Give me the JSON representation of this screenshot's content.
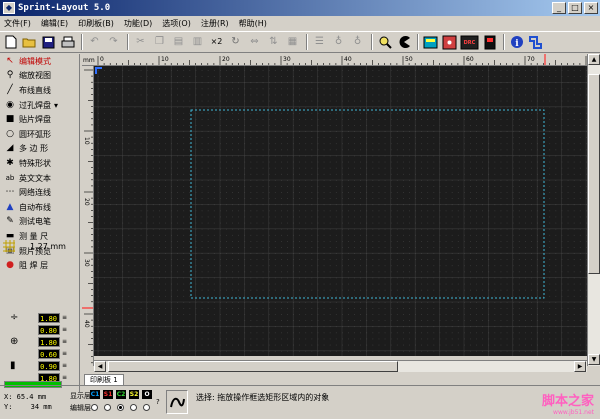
{
  "window": {
    "title": "Sprint-Layout 5.0",
    "minimize": "_",
    "maximize": "□",
    "close": "×"
  },
  "menu": [
    "文件(F)",
    "编辑(E)",
    "印刷板(B)",
    "功能(D)",
    "选项(O)",
    "注册(R)",
    "帮助(H)"
  ],
  "toolbar": {
    "new_icon": "file-new-icon",
    "open_icon": "folder-open-icon",
    "save_icon": "save-icon",
    "print_icon": "print-icon",
    "zoom_badge": "×2",
    "drc_label": "DRC"
  },
  "tools": [
    {
      "label": "编辑模式",
      "icon": "cursor-arrow-icon",
      "selected": true
    },
    {
      "label": "缩放视图",
      "icon": "zoom-icon"
    },
    {
      "label": "布线直线",
      "icon": "track-icon"
    },
    {
      "label": "过孔焊盘",
      "icon": "via-pad-icon",
      "has_arrow": true
    },
    {
      "label": "贴片焊盘",
      "icon": "smd-pad-icon"
    },
    {
      "label": "圆环弧形",
      "icon": "circle-arc-icon"
    },
    {
      "label": "多 边 形",
      "icon": "polygon-icon"
    },
    {
      "label": "特殊形状",
      "icon": "special-shape-icon"
    },
    {
      "label": "英文文本",
      "icon": "text-icon"
    },
    {
      "label": "网络连线",
      "icon": "net-connect-icon"
    },
    {
      "label": "自动布线",
      "icon": "autoroute-icon"
    },
    {
      "label": "测试电笔",
      "icon": "test-probe-icon"
    },
    {
      "label": "测 量 尺",
      "icon": "ruler-icon"
    },
    {
      "label": "照片预览",
      "icon": "photo-preview-icon"
    },
    {
      "label": "阻 焊 层",
      "icon": "solder-mask-icon"
    }
  ],
  "grid": {
    "value": "1.27 mm"
  },
  "params": [
    {
      "value": "1.80",
      "unit": "≡"
    },
    {
      "value": "0.80",
      "unit": "≡"
    },
    {
      "value": "1.80",
      "unit": "≡"
    },
    {
      "value": "0.60",
      "unit": "≡"
    },
    {
      "value": "0.90",
      "unit": "≡"
    },
    {
      "value": "1.80",
      "unit": "≡"
    }
  ],
  "ruler": {
    "unit": "mm",
    "top_marks": [
      "0",
      "10",
      "20",
      "30",
      "40",
      "50",
      "60",
      "70"
    ],
    "left_marks": [
      "10",
      "20",
      "30",
      "40"
    ]
  },
  "tab": {
    "label": "印刷板 1"
  },
  "status": {
    "x_label": "X:",
    "x_value": "65.4 mm",
    "y_label": "Y:",
    "y_value": "34 mm",
    "display_layer_label": "显示层",
    "edit_layer_label": "编辑层",
    "layers": [
      {
        "name": "C1",
        "color": "#00a0ff"
      },
      {
        "name": "S1",
        "color": "#ff3030"
      },
      {
        "name": "C2",
        "color": "#30d030"
      },
      {
        "name": "S2",
        "color": "#ffff30"
      },
      {
        "name": "O",
        "color": "#ffffff"
      }
    ],
    "help_mark": "?",
    "message": "选择: 拖放操作框选矩形区域内的对象"
  },
  "watermark": {
    "text": "脚本之家",
    "url": "www.jb51.net"
  },
  "colors": {
    "canvas_bg": "#1c1c1c",
    "outline": "#3fb8d8",
    "grid": "#3a3a3a",
    "origin_marker": "#ff3030"
  }
}
